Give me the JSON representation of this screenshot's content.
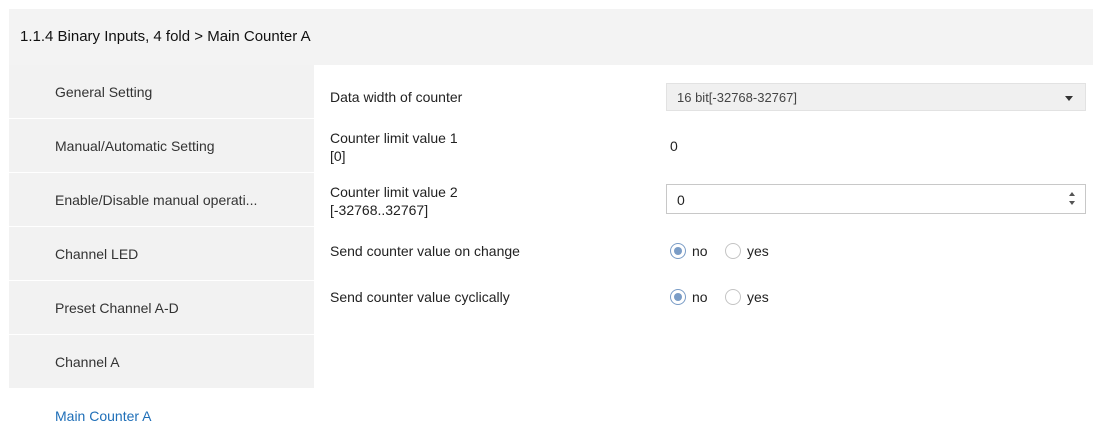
{
  "header": {
    "title": "1.1.4 Binary Inputs, 4 fold > Main Counter A"
  },
  "sidebar": {
    "items": [
      {
        "label": "General Setting"
      },
      {
        "label": "Manual/Automatic Setting"
      },
      {
        "label": "Enable/Disable manual operati..."
      },
      {
        "label": "Channel LED"
      },
      {
        "label": "Preset Channel A-D"
      },
      {
        "label": "Channel A"
      },
      {
        "label": "Main Counter A",
        "active": true
      }
    ]
  },
  "params": {
    "data_width": {
      "label": "Data width of counter",
      "value": "16 bit[-32768-32767]"
    },
    "limit1": {
      "label": "Counter limit value 1",
      "range": "[0]",
      "value": "0"
    },
    "limit2": {
      "label": "Counter limit value 2",
      "range": "[-32768..32767]",
      "value": "0"
    },
    "send_on_change": {
      "label": "Send counter value on change",
      "options": [
        "no",
        "yes"
      ],
      "selected": "no"
    },
    "send_cyclic": {
      "label": "Send counter value cyclically",
      "options": [
        "no",
        "yes"
      ],
      "selected": "no"
    }
  },
  "colors": {
    "accent": "#1f6fb8",
    "sidebar_bg": "#f2f2f2",
    "header_bg": "#f3f3f3",
    "radio_checked": "#7a9cc6"
  },
  "icons": {
    "dropdown": "chevron-down-icon",
    "spin_up": "arrow-up-icon",
    "spin_down": "arrow-down-icon"
  }
}
